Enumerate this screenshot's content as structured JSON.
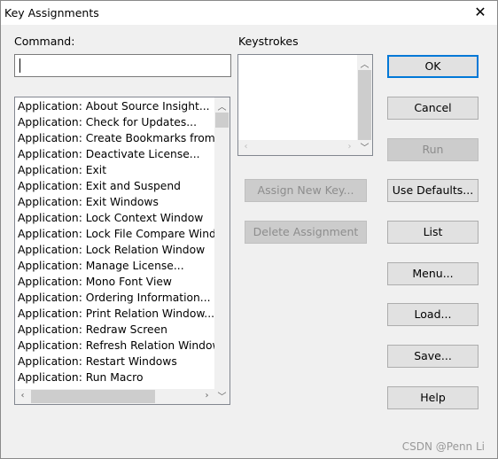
{
  "window": {
    "title": "Key Assignments",
    "close": "✕"
  },
  "command": {
    "label": "Command:",
    "value": "",
    "items": [
      "Application: About Source Insight...",
      "Application: Check for Updates...",
      "Application: Create Bookmarks from F",
      "Application: Deactivate License...",
      "Application: Exit",
      "Application: Exit and Suspend",
      "Application: Exit Windows",
      "Application: Lock Context Window",
      "Application: Lock File Compare Windo",
      "Application: Lock Relation Window",
      "Application: Manage License...",
      "Application: Mono Font View",
      "Application: Ordering Information...",
      "Application: Print Relation Window...",
      "Application: Redraw Screen",
      "Application: Refresh Relation Window",
      "Application: Restart Windows",
      "Application: Run Macro"
    ]
  },
  "keystrokes": {
    "label": "Keystrokes"
  },
  "buttons": {
    "ok": "OK",
    "cancel": "Cancel",
    "run": "Run",
    "use_defaults": "Use Defaults...",
    "list": "List",
    "menu": "Menu...",
    "load": "Load...",
    "save": "Save...",
    "help": "Help",
    "assign": "Assign New Key...",
    "delete": "Delete Assignment"
  },
  "watermark": "CSDN @Penn Li",
  "colors": {
    "accent": "#0078d7"
  }
}
